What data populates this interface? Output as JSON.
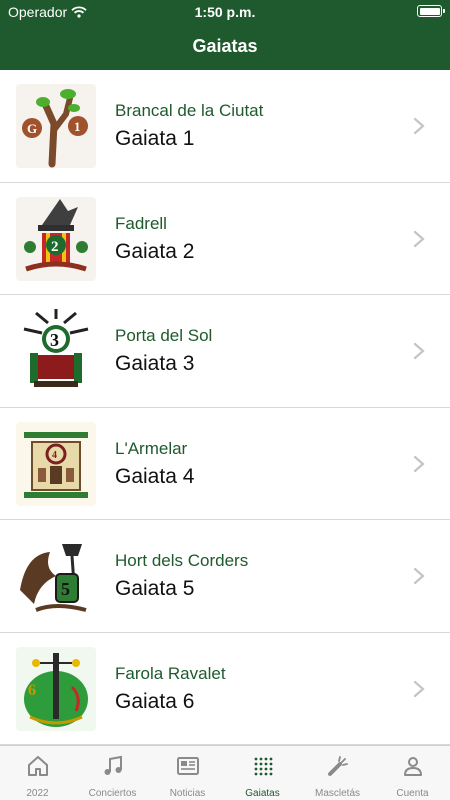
{
  "status_bar": {
    "carrier": "Operador",
    "time": "1:50 p.m."
  },
  "nav": {
    "title": "Gaiatas"
  },
  "colors": {
    "brand": "#1e5a2d",
    "separator": "#d8d8d8",
    "tab_inactive": "#8a8a8a"
  },
  "gaiatas": [
    {
      "subtitle": "Brancal de la Ciutat",
      "title": "Gaiata 1",
      "icon": "gaiata-1-emblem-icon"
    },
    {
      "subtitle": "Fadrell",
      "title": "Gaiata 2",
      "icon": "gaiata-2-emblem-icon"
    },
    {
      "subtitle": "Porta del Sol",
      "title": "Gaiata 3",
      "icon": "gaiata-3-emblem-icon"
    },
    {
      "subtitle": "L'Armelar",
      "title": "Gaiata 4",
      "icon": "gaiata-4-emblem-icon"
    },
    {
      "subtitle": "Hort dels Corders",
      "title": "Gaiata 5",
      "icon": "gaiata-5-emblem-icon"
    },
    {
      "subtitle": "Farola Ravalet",
      "title": "Gaiata 6",
      "icon": "gaiata-6-emblem-icon"
    }
  ],
  "tabs": [
    {
      "label": "2022",
      "icon": "home-icon"
    },
    {
      "label": "Conciertos",
      "icon": "music-note-icon"
    },
    {
      "label": "Noticias",
      "icon": "newspaper-icon"
    },
    {
      "label": "Gaiatas",
      "icon": "grid-dots-icon",
      "active": true
    },
    {
      "label": "Mascletás",
      "icon": "firecracker-icon"
    },
    {
      "label": "Cuenta",
      "icon": "person-icon"
    }
  ]
}
